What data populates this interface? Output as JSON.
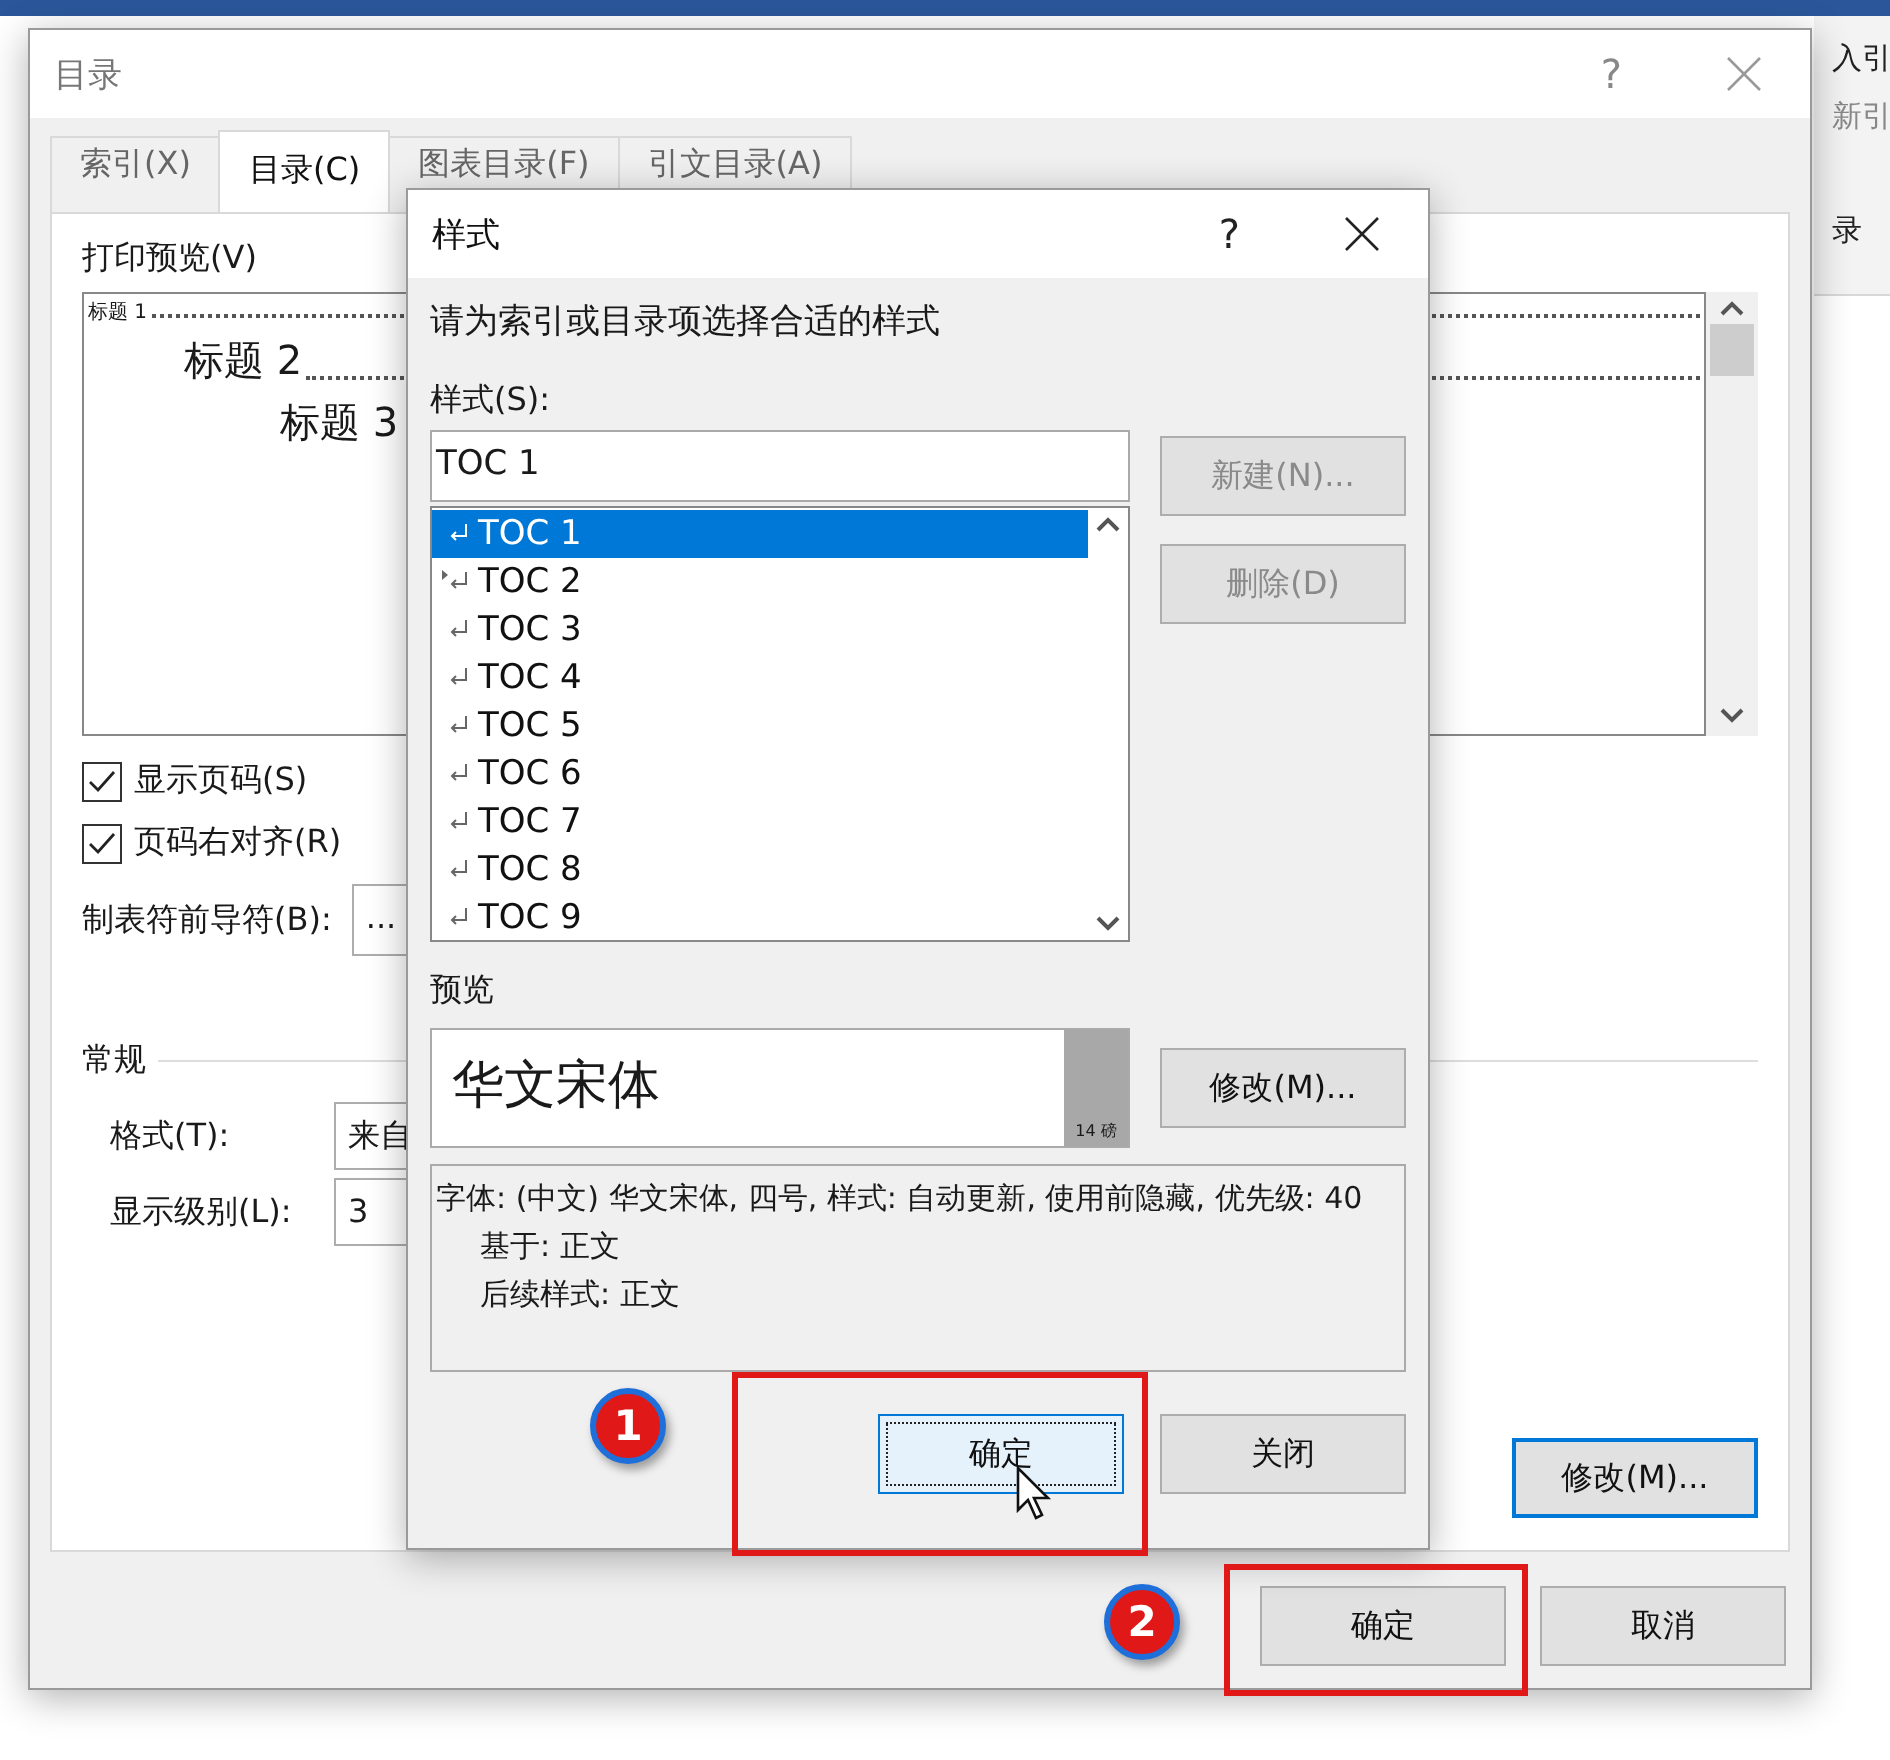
{
  "background": {
    "ribbon_labels": [
      "入引",
      "新引",
      "录"
    ]
  },
  "toc_dialog": {
    "title": "目录",
    "help_label": "?",
    "tabs": [
      {
        "label": "索引(X)",
        "selected": false
      },
      {
        "label": "目录(C)",
        "selected": true
      },
      {
        "label": "图表目录(F)",
        "selected": false
      },
      {
        "label": "引文目录(A)",
        "selected": false
      }
    ],
    "print_preview": {
      "label": "打印预览(V)",
      "lines": [
        {
          "kind": "h1",
          "text": "标题 1"
        },
        {
          "kind": "h2",
          "text": "标题 2"
        },
        {
          "kind": "h3",
          "text": "标题 3"
        }
      ]
    },
    "checkboxes": [
      {
        "label": "显示页码(S)",
        "checked": true
      },
      {
        "label": "页码右对齐(R)",
        "checked": true
      }
    ],
    "tab_leader": {
      "label": "制表符前导符(B):",
      "value": "..."
    },
    "general": {
      "title": "常规",
      "fields": [
        {
          "label": "格式(T):",
          "value": "来自"
        },
        {
          "label": "显示级别(L):",
          "value": "3"
        }
      ]
    },
    "modify_button": {
      "label": "修改(M)...",
      "default": true
    },
    "buttons": [
      {
        "label": "确定",
        "default": false
      },
      {
        "label": "取消",
        "default": false
      }
    ]
  },
  "style_dialog": {
    "title": "样式",
    "help_label": "?",
    "instruction": "请为索引或目录项选择合适的样式",
    "style_label": "样式(S):",
    "style_value": "TOC 1",
    "styles": [
      {
        "name": "TOC 1",
        "kind": "paragraph",
        "selected": true
      },
      {
        "name": "TOC 2",
        "kind": "linked",
        "selected": false
      },
      {
        "name": "TOC 3",
        "kind": "paragraph",
        "selected": false
      },
      {
        "name": "TOC 4",
        "kind": "paragraph",
        "selected": false
      },
      {
        "name": "TOC 5",
        "kind": "paragraph",
        "selected": false
      },
      {
        "name": "TOC 6",
        "kind": "paragraph",
        "selected": false
      },
      {
        "name": "TOC 7",
        "kind": "paragraph",
        "selected": false
      },
      {
        "name": "TOC 8",
        "kind": "paragraph",
        "selected": false
      },
      {
        "name": "TOC 9",
        "kind": "paragraph",
        "selected": false
      }
    ],
    "side_buttons": [
      {
        "label": "新建(N)...",
        "disabled": true
      },
      {
        "label": "删除(D)",
        "disabled": true
      }
    ],
    "preview_label": "预览",
    "preview_text": "华文宋体",
    "preview_size": "14 磅",
    "modify_button": "修改(M)...",
    "description": [
      "字体: (中文) 华文宋体, 四号, 样式: 自动更新, 使用前隐藏, 优先级: 40",
      "基于: 正文",
      "后续样式: 正文"
    ],
    "buttons": [
      {
        "label": "确定",
        "focused": true
      },
      {
        "label": "关闭",
        "focused": false
      }
    ]
  },
  "annotations": [
    {
      "number": "1"
    },
    {
      "number": "2"
    }
  ]
}
